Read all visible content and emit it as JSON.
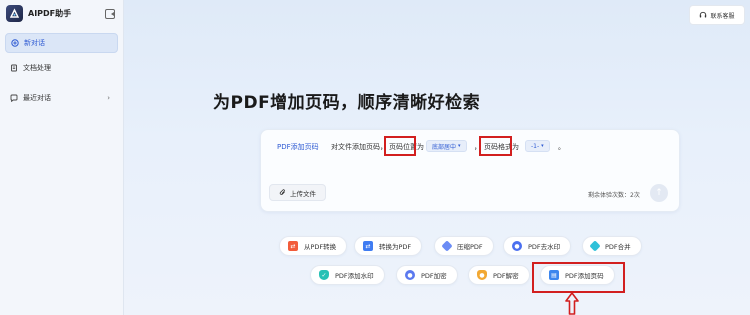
{
  "app": {
    "name": "AIPDF助手"
  },
  "sidebar": {
    "items": [
      {
        "label": "新对话"
      },
      {
        "label": "文档处理"
      },
      {
        "label": "最近对话"
      }
    ]
  },
  "header": {
    "support_label": "联系客服"
  },
  "main": {
    "headline": "为PDF增加页码，顺序清晰好检索",
    "card": {
      "tool_label": "PDF添加页码",
      "prefix_text": "对文件添加页码，",
      "position_label": "页码位置为",
      "position_value": "底部居中",
      "comma": "，",
      "format_label": "页码格式为",
      "format_value": "-1-",
      "period": "。",
      "upload_label": "上传文件",
      "remaining_label": "剩余体验次数：2次"
    },
    "tools_row1": [
      {
        "label": "从PDF转换",
        "icon": "pdf-convert-from-icon",
        "color": "#f25c3a"
      },
      {
        "label": "转换为PDF",
        "icon": "convert-to-pdf-icon",
        "color": "#3f7cf2"
      },
      {
        "label": "压缩PDF",
        "icon": "compress-pdf-icon",
        "color": "#6b8cf5"
      },
      {
        "label": "PDF去水印",
        "icon": "remove-watermark-icon",
        "color": "#4a6ff0"
      },
      {
        "label": "PDF合并",
        "icon": "merge-pdf-icon",
        "color": "#2fc1d9"
      }
    ],
    "tools_row2": [
      {
        "label": "PDF添加水印",
        "icon": "add-watermark-icon",
        "color": "#27c1b5"
      },
      {
        "label": "PDF加密",
        "icon": "encrypt-pdf-icon",
        "color": "#5b79ef"
      },
      {
        "label": "PDF解密",
        "icon": "decrypt-pdf-icon",
        "color": "#f2a833"
      },
      {
        "label": "PDF添加页码",
        "icon": "add-page-number-icon",
        "color": "#3c86ee"
      }
    ]
  },
  "colors": {
    "accent": "#2f5bd3",
    "highlight": "#d21f1f"
  }
}
